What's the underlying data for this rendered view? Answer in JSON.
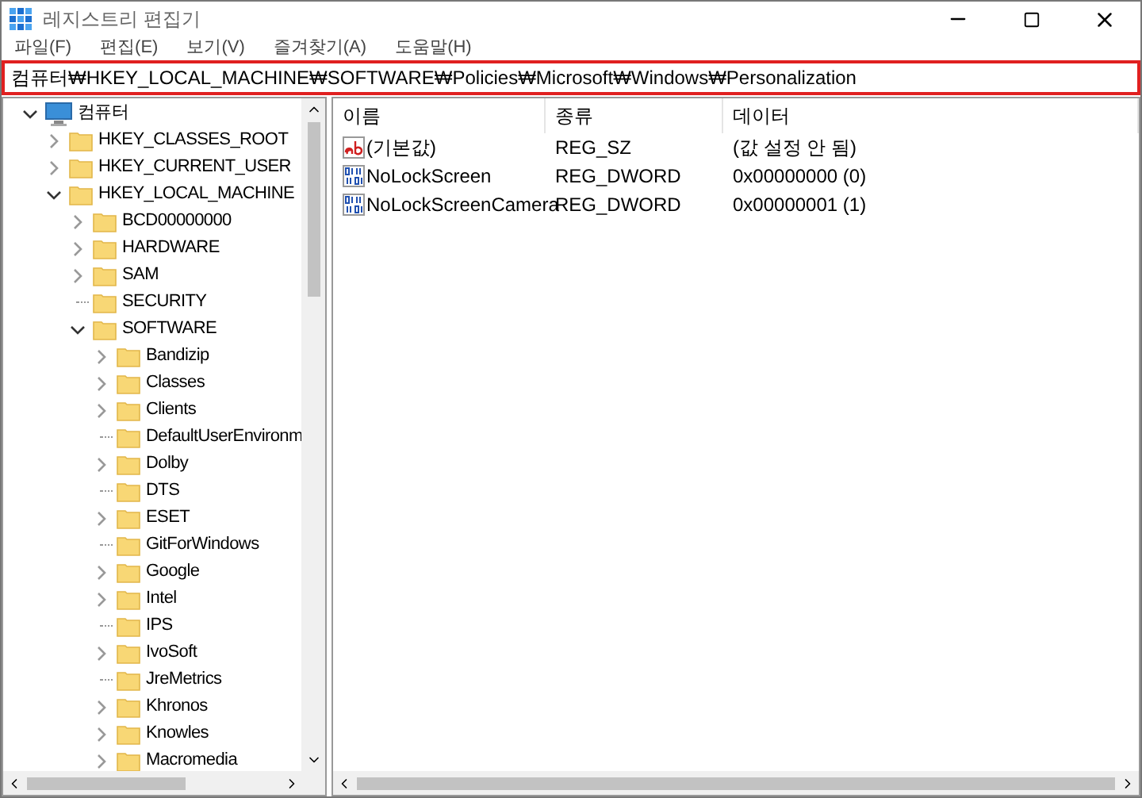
{
  "window": {
    "title": "레지스트리 편집기"
  },
  "menu": [
    "파일(F)",
    "편집(E)",
    "보기(V)",
    "즐겨찾기(A)",
    "도움말(H)"
  ],
  "address": "컴퓨터₩HKEY_LOCAL_MACHINE₩SOFTWARE₩Policies₩Microsoft₩Windows₩Personalization",
  "tree": [
    {
      "label": "컴퓨터",
      "kind": "computer",
      "expandable": true,
      "expanded": true,
      "children": [
        {
          "label": "HKEY_CLASSES_ROOT",
          "expandable": true,
          "expanded": false
        },
        {
          "label": "HKEY_CURRENT_USER",
          "expandable": true,
          "expanded": false
        },
        {
          "label": "HKEY_LOCAL_MACHINE",
          "expandable": true,
          "expanded": true,
          "children": [
            {
              "label": "BCD00000000",
              "expandable": true,
              "expanded": false
            },
            {
              "label": "HARDWARE",
              "expandable": true,
              "expanded": false
            },
            {
              "label": "SAM",
              "expandable": true,
              "expanded": false
            },
            {
              "label": "SECURITY",
              "expandable": false
            },
            {
              "label": "SOFTWARE",
              "expandable": true,
              "expanded": true,
              "children": [
                {
                  "label": "Bandizip",
                  "expandable": true,
                  "expanded": false
                },
                {
                  "label": "Classes",
                  "expandable": true,
                  "expanded": false
                },
                {
                  "label": "Clients",
                  "expandable": true,
                  "expanded": false
                },
                {
                  "label": "DefaultUserEnvironm",
                  "expandable": false
                },
                {
                  "label": "Dolby",
                  "expandable": true,
                  "expanded": false
                },
                {
                  "label": "DTS",
                  "expandable": false
                },
                {
                  "label": "ESET",
                  "expandable": true,
                  "expanded": false
                },
                {
                  "label": "GitForWindows",
                  "expandable": false
                },
                {
                  "label": "Google",
                  "expandable": true,
                  "expanded": false
                },
                {
                  "label": "Intel",
                  "expandable": true,
                  "expanded": false
                },
                {
                  "label": "IPS",
                  "expandable": false
                },
                {
                  "label": "IvoSoft",
                  "expandable": true,
                  "expanded": false
                },
                {
                  "label": "JreMetrics",
                  "expandable": false
                },
                {
                  "label": "Khronos",
                  "expandable": true,
                  "expanded": false
                },
                {
                  "label": "Knowles",
                  "expandable": true,
                  "expanded": false
                },
                {
                  "label": "Macromedia",
                  "expandable": true,
                  "expanded": false
                }
              ]
            }
          ]
        }
      ]
    }
  ],
  "table": {
    "columns": [
      "이름",
      "종류",
      "데이터"
    ],
    "rows": [
      {
        "kind": "string",
        "name": "(기본값)",
        "type": "REG_SZ",
        "data": "(값 설정 안 됨)"
      },
      {
        "kind": "binary",
        "name": "NoLockScreen",
        "type": "REG_DWORD",
        "data": "0x00000000 (0)"
      },
      {
        "kind": "binary",
        "name": "NoLockScreenCamera",
        "type": "REG_DWORD",
        "data": "0x00000001 (1)"
      }
    ]
  }
}
